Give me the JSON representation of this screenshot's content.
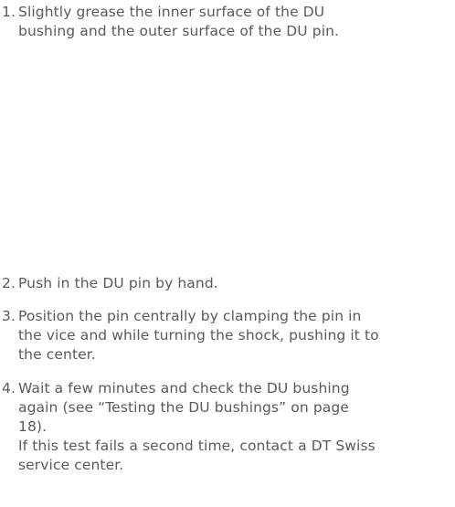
{
  "steps": [
    {
      "number": "1.",
      "lines": [
        "Slightly grease the inner surface of the DU",
        "bushing and the outer surface of the DU pin."
      ]
    },
    {
      "number": "2.",
      "lines": [
        "Push in the DU pin by hand."
      ]
    },
    {
      "number": "3.",
      "lines": [
        "Position the pin centrally by clamping the pin in",
        "the vice and while turning the shock, pushing it to",
        "the center."
      ]
    },
    {
      "number": "4.",
      "lines": [
        "Wait a few minutes and check the DU bushing",
        "again (see “Testing the DU bushings” on page",
        "18).",
        "If this test fails a second time, contact a DT Swiss",
        "service center."
      ]
    }
  ]
}
